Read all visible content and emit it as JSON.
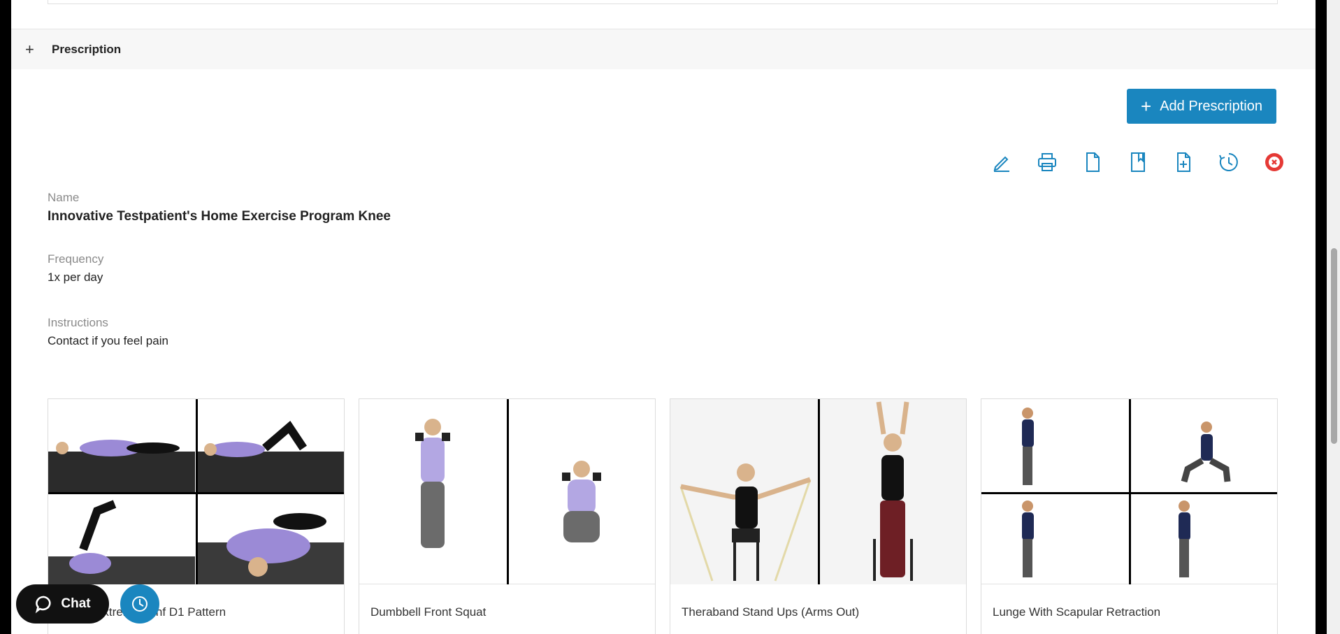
{
  "section": {
    "title": "Prescription"
  },
  "actions": {
    "add_label": "Add Prescription"
  },
  "toolbar": {
    "icons": [
      "edit-icon",
      "print-icon",
      "document-icon",
      "bookmark-icon",
      "add-document-icon",
      "history-icon",
      "record-icon"
    ]
  },
  "prescription": {
    "name_label": "Name",
    "name_value": "Innovative Testpatient's Home Exercise Program Knee",
    "frequency_label": "Frequency",
    "frequency_value": "1x per day",
    "instructions_label": "Instructions",
    "instructions_value": "Contact if you feel pain"
  },
  "exercises": [
    {
      "title": "Lower Extremity Pnf D1 Pattern"
    },
    {
      "title": "Dumbbell Front Squat"
    },
    {
      "title": "Theraband Stand Ups (Arms Out)"
    },
    {
      "title": "Lunge With Scapular Retraction"
    }
  ],
  "widgets": {
    "chat_label": "Chat"
  },
  "colors": {
    "accent": "#1a86bf",
    "record": "#e53935"
  }
}
